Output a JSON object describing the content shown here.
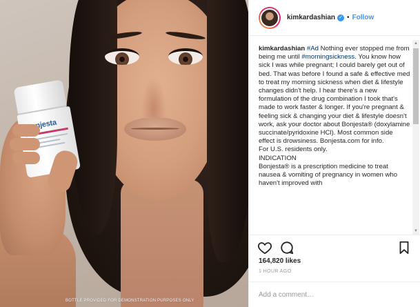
{
  "photo": {
    "bottle_brand": "Bonjesta",
    "disclaimer": "BOTTLE PROVIDED FOR DEMONSTRATION PURPOSES ONLY"
  },
  "header": {
    "username": "kimkardashian",
    "separator": "•",
    "follow_label": "Follow"
  },
  "caption": {
    "username": "kimkardashian",
    "hashtag_ad": "#Ad",
    "text_1": " Nothing ever stopped me from being me until ",
    "hashtag_morning": "#morningsickness",
    "text_2": ". You know how sick I was while pregnant; I could barely get out of bed. That was before I found a safe & effective med to treat my morning sickness when diet & lifestyle changes didn't help. I hear there's a new formulation of the drug combination I took that's made to work faster & longer. If you're pregnant & feeling sick & changing your diet & lifestyle doesn't work, ask your doctor about Bonjesta® (doxylamine succinate/pyridoxine HCl). Most common side effect is drowsiness. Bonjesta.com for info.",
    "line_residents": "For U.S. residents only.",
    "line_indication": "INDICATION",
    "line_indication_text": "Bonjesta® is a prescription medicine to treat nausea & vomiting of pregnancy in women who haven't improved with"
  },
  "icons": {
    "like": "heart-icon",
    "comment": "comment-icon",
    "save": "bookmark-icon",
    "verified": "verified-badge-icon"
  },
  "likes": "164,820 likes",
  "timestamp": "1 HOUR AGO",
  "comment_placeholder": "Add a comment…",
  "colors": {
    "link_blue": "#3897f0",
    "hashtag": "#003569",
    "text": "#262626",
    "muted": "#999999"
  }
}
